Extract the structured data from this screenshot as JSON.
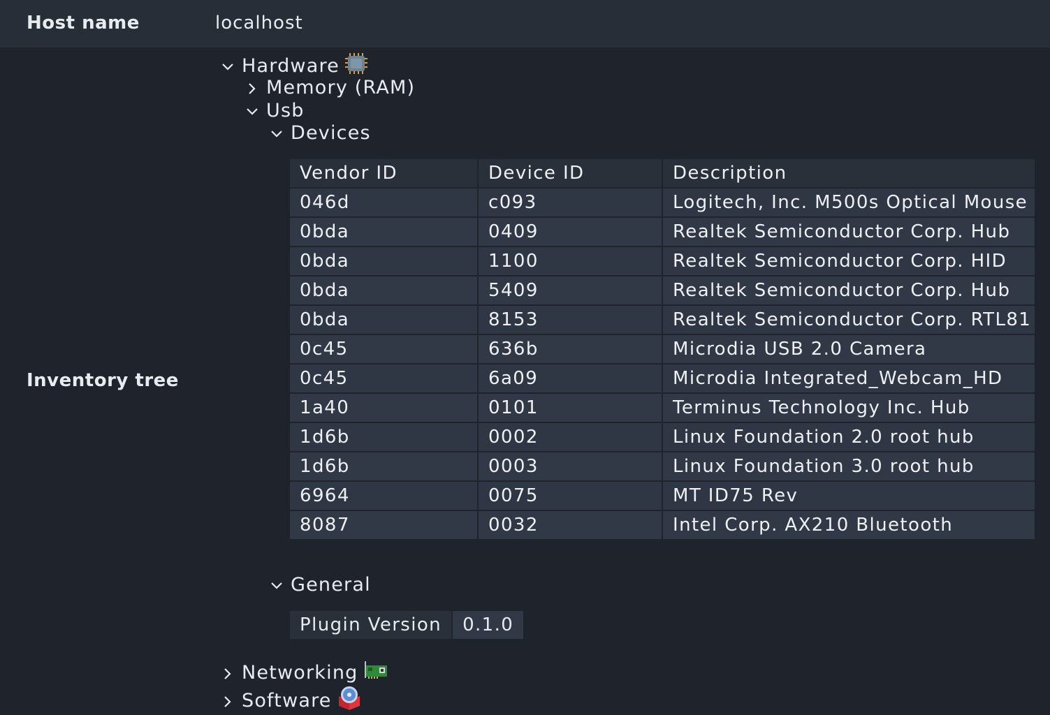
{
  "host": {
    "label": "Host name",
    "value": "localhost"
  },
  "inventory": {
    "label": "Inventory tree",
    "hardware": {
      "label": "Hardware",
      "icon": "cpu-chip-icon"
    },
    "memory": {
      "label": "Memory (RAM)"
    },
    "usb": {
      "label": "Usb"
    },
    "devices": {
      "label": "Devices",
      "columns": [
        "Vendor ID",
        "Device ID",
        "Description"
      ],
      "rows": [
        [
          "046d",
          "c093",
          "Logitech, Inc. M500s Optical Mouse"
        ],
        [
          "0bda",
          "0409",
          "Realtek Semiconductor Corp. Hub"
        ],
        [
          "0bda",
          "1100",
          "Realtek Semiconductor Corp. HID"
        ],
        [
          "0bda",
          "5409",
          "Realtek Semiconductor Corp. Hub"
        ],
        [
          "0bda",
          "8153",
          "Realtek Semiconductor Corp. RTL81"
        ],
        [
          "0c45",
          "636b",
          "Microdia USB 2.0 Camera"
        ],
        [
          "0c45",
          "6a09",
          "Microdia Integrated_Webcam_HD"
        ],
        [
          "1a40",
          "0101",
          "Terminus Technology Inc. Hub"
        ],
        [
          "1d6b",
          "0002",
          "Linux Foundation 2.0 root hub"
        ],
        [
          "1d6b",
          "0003",
          "Linux Foundation 3.0 root hub"
        ],
        [
          "6964",
          "0075",
          "MT ID75 Rev"
        ],
        [
          "8087",
          "0032",
          "Intel Corp. AX210 Bluetooth"
        ]
      ]
    },
    "general": {
      "label": "General",
      "plugin_key": "Plugin Version",
      "plugin_value": "0.1.0"
    },
    "networking": {
      "label": "Networking",
      "icon": "network-card-icon"
    },
    "software": {
      "label": "Software",
      "icon": "software-disc-icon"
    }
  }
}
